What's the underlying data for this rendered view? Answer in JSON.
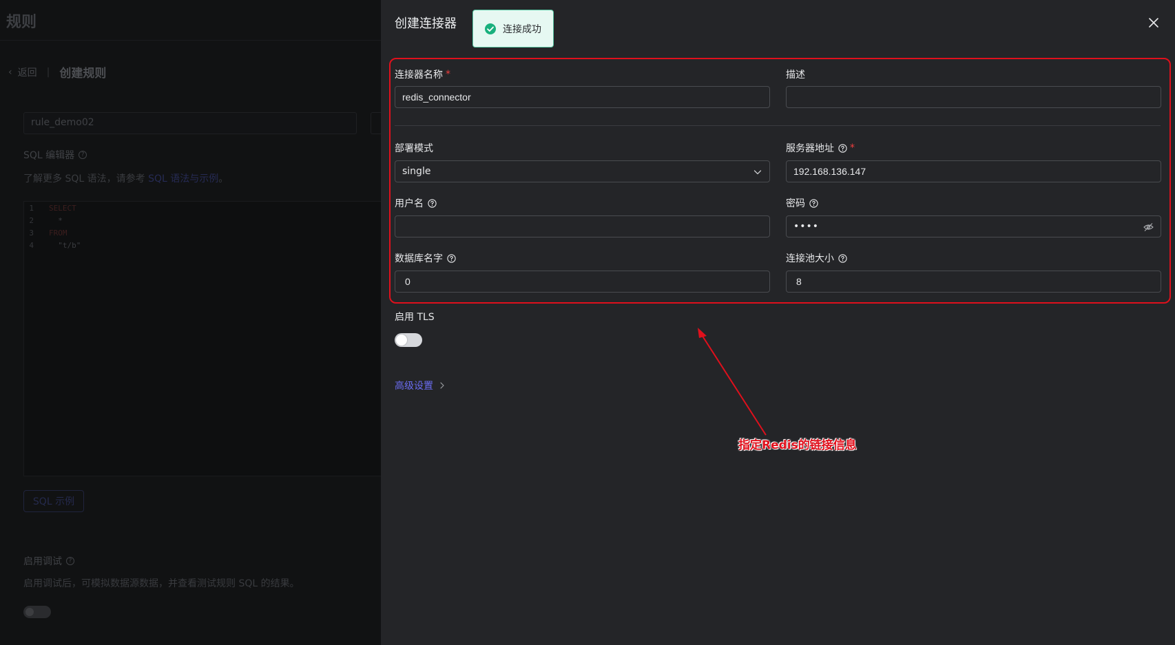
{
  "background": {
    "title": "规则",
    "back_label": "返回",
    "page_title": "创建规则",
    "rule_name_value": "rule_demo02",
    "sql_editor_label": "SQL 编辑器",
    "sql_hint_prefix": "了解更多 SQL 语法，请参考 ",
    "sql_hint_link": "SQL 语法与示例",
    "sql_hint_suffix": "。",
    "code_lines": [
      {
        "n": "1",
        "text": "SELECT",
        "kind": "kw"
      },
      {
        "n": "2",
        "text": "  *",
        "kind": "tx"
      },
      {
        "n": "3",
        "text": "FROM",
        "kind": "kw"
      },
      {
        "n": "4",
        "text": "  \"t/b\"",
        "kind": "tx"
      }
    ],
    "sql_example_button": "SQL 示例",
    "debug_label": "启用调试",
    "debug_hint": "启用调试后，可模拟数据源数据，并查看测试规则 SQL 的结果。"
  },
  "drawer": {
    "title": "创建连接器",
    "toast": "连接成功",
    "fields": {
      "connector_name": {
        "label": "连接器名称",
        "required": "*",
        "value": "redis_connector"
      },
      "description": {
        "label": "描述",
        "value": ""
      },
      "deploy_mode": {
        "label": "部署模式",
        "value": "single"
      },
      "server_address": {
        "label": "服务器地址",
        "required": "*",
        "value": "192.168.136.147"
      },
      "username": {
        "label": "用户名",
        "value": ""
      },
      "password": {
        "label": "密码",
        "value": "••••"
      },
      "database_name": {
        "label": "数据库名字",
        "value": "0"
      },
      "pool_size": {
        "label": "连接池大小",
        "value": "8"
      }
    },
    "tls_label": "启用 TLS",
    "tls_enabled": false,
    "advanced_settings": "高级设置"
  },
  "annotation": {
    "text": "指定Redis的链接信息",
    "color": "#e0101c"
  }
}
